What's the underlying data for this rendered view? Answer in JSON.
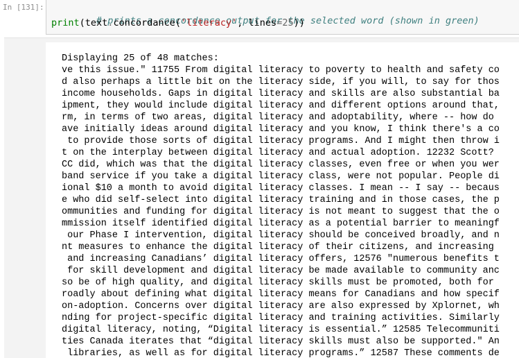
{
  "input_cell": {
    "prompt": "In [131]:",
    "comment": "# prints a concordance output for the selected word (shown in green)",
    "code": {
      "func": "print",
      "open": "(",
      "obj": "text",
      "dot": ".",
      "method": "concordance",
      "open2": "(",
      "arg_str": "'literacy'",
      "comma": ", ",
      "kwarg": "lines",
      "eq": "=",
      "num": "25",
      "close": "))"
    }
  },
  "output_cell": {
    "lines": [
      "Displaying 25 of 48 matches:",
      "ve this issue.\" 11755 From digital literacy to poverty to health and safety co",
      "d also perhaps a little bit on the literacy side, if you will, to say for thos",
      "income households. Gaps in digital literacy and skills are also substantial ba",
      "ipment, they would include digital literacy and different options around that,",
      "rm, in terms of two areas, digital literacy and adoptability, where -- how do",
      "ave initially ideas around digital literacy and you know, I think there's a co",
      " to provide those sorts of digital literacy programs. And I might then throw i",
      "t on the interplay between digital literacy and actual adoption. 12232 Scott?",
      "CC did, which was that the digital literacy classes, even free or when you wer",
      "band service if you take a digital literacy class, were not popular. People di",
      "ional $10 a month to avoid digital literacy classes. I mean -- I say -- becaus",
      "e who did self-select into digital literacy training and in those cases, the p",
      "ommunities and funding for digital literacy is not meant to suggest that the o",
      "mmission itself identified digital literacy as a potential barrier to meaningf",
      " our Phase I intervention, digital literacy should be conceived broadly, and n",
      "nt measures to enhance the digital literacy of their citizens, and increasing",
      " and increasing Canadians’ digital literacy offers, 12576 \"numerous benefits t",
      " for skill development and digital literacy be made available to community anc",
      "so be of high quality, and digital literacy skills must be promoted, both for",
      "roadly about defining what digital literacy means for Canadians and how specif",
      "on-adoption. Concerns over digital literacy are also expressed by Xplornet, wh",
      "nding for project-specific digital literacy and training activities. Similarly",
      "digital literacy, noting, “Digital literacy is essential.” 12585 Telecommuniti",
      "ties Canada iterates that “digital literacy skills must also be supported.\" An",
      " libraries, as well as for digital literacy programs.” 12587 These comments de"
    ]
  }
}
